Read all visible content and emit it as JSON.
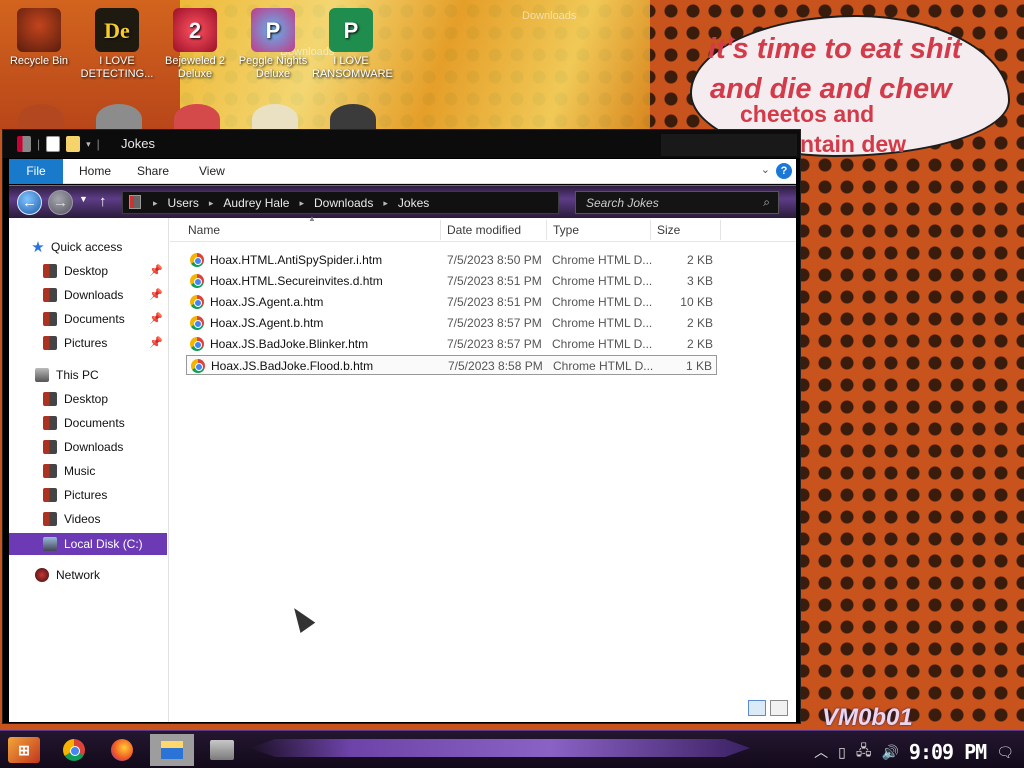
{
  "desktop": {
    "icons": [
      {
        "label": "Recycle Bin",
        "glyph": ""
      },
      {
        "label": "I LOVE DETECTING...",
        "glyph": "De"
      },
      {
        "label": "Bejeweled 2 Deluxe",
        "glyph": "2"
      },
      {
        "label": "Peggle Nights Deluxe",
        "glyph": "P"
      },
      {
        "label": "I LOVE RANSOMWARE",
        "glyph": "P"
      }
    ],
    "speech_bubble": {
      "line1": "it's time to eat shit",
      "line2": "and die and chew",
      "line3": "cheetos and",
      "line4": "ntain dew"
    },
    "watermark": "VM0b01",
    "ghost_text": "Downloads"
  },
  "window": {
    "title": "Jokes",
    "ribbon": {
      "tabs": [
        "File",
        "Home",
        "Share",
        "View"
      ],
      "help": "?"
    },
    "address": {
      "crumbs": [
        "Users",
        "Audrey Hale",
        "Downloads",
        "Jokes"
      ]
    },
    "search": {
      "placeholder": "Search Jokes"
    },
    "sidebar": {
      "quick_access": "Quick access",
      "quick_items": [
        "Desktop",
        "Downloads",
        "Documents",
        "Pictures"
      ],
      "this_pc": "This PC",
      "pc_items": [
        "Desktop",
        "Documents",
        "Downloads",
        "Music",
        "Pictures",
        "Videos"
      ],
      "local_disk": "Local Disk (C:)",
      "network": "Network"
    },
    "columns": [
      "Name",
      "Date modified",
      "Type",
      "Size"
    ],
    "files": [
      {
        "name": "Hoax.HTML.AntiSpySpider.i.htm",
        "date": "7/5/2023 8:50 PM",
        "type": "Chrome HTML D...",
        "size": "2 KB"
      },
      {
        "name": "Hoax.HTML.Secureinvites.d.htm",
        "date": "7/5/2023 8:51 PM",
        "type": "Chrome HTML D...",
        "size": "3 KB"
      },
      {
        "name": "Hoax.JS.Agent.a.htm",
        "date": "7/5/2023 8:51 PM",
        "type": "Chrome HTML D...",
        "size": "10 KB"
      },
      {
        "name": "Hoax.JS.Agent.b.htm",
        "date": "7/5/2023 8:57 PM",
        "type": "Chrome HTML D...",
        "size": "2 KB"
      },
      {
        "name": "Hoax.JS.BadJoke.Blinker.htm",
        "date": "7/5/2023 8:57 PM",
        "type": "Chrome HTML D...",
        "size": "2 KB"
      },
      {
        "name": "Hoax.JS.BadJoke.Flood.b.htm",
        "date": "7/5/2023 8:58 PM",
        "type": "Chrome HTML D...",
        "size": "1 KB"
      }
    ],
    "selected_index": 5
  },
  "taskbar": {
    "clock": "9:09 PM"
  },
  "colors": {
    "accent_purple": "#6d3ab5",
    "file_tab_blue": "#1979ca",
    "bubble_text": "#d33b4a",
    "wallpaper_orange": "#c8531c"
  }
}
